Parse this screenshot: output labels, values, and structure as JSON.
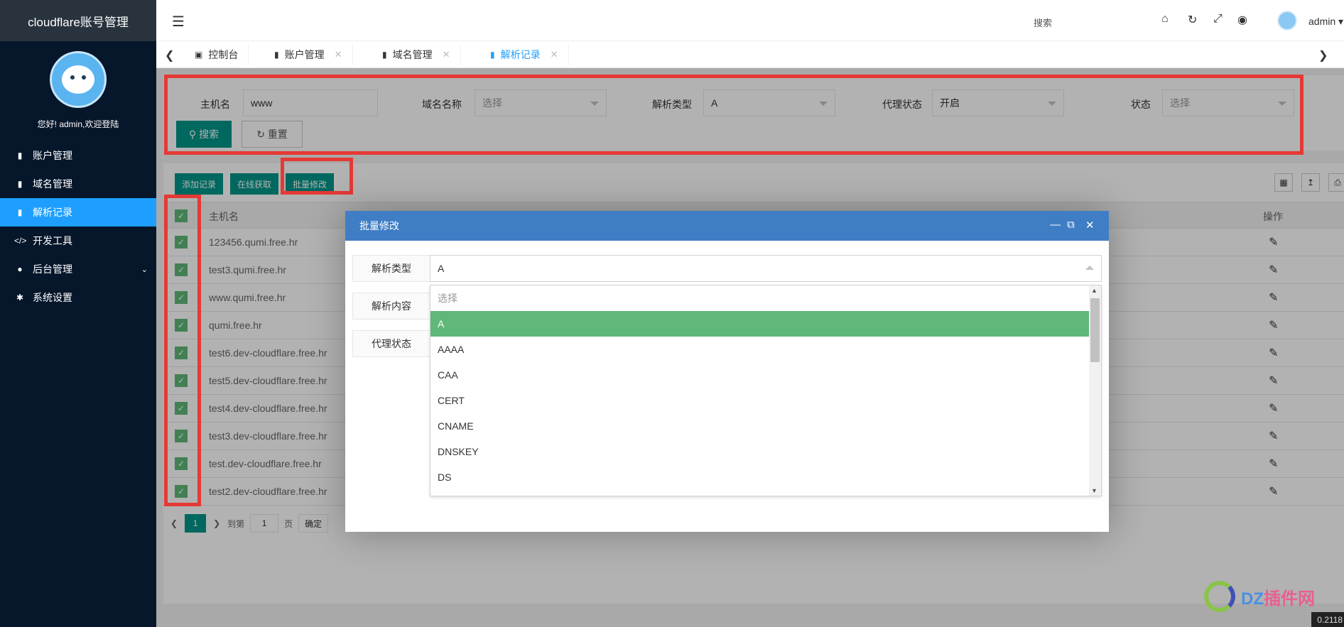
{
  "app": {
    "brand": "cloudflare账号管理",
    "welcome": "您好! admin,欢迎登陆"
  },
  "sidebar": {
    "items": [
      {
        "label": "账户管理",
        "icon": "book-icon"
      },
      {
        "label": "域名管理",
        "icon": "book-icon"
      },
      {
        "label": "解析记录",
        "icon": "book-icon",
        "active": true
      },
      {
        "label": "开发工具",
        "icon": "code-icon"
      },
      {
        "label": "后台管理",
        "icon": "users-icon",
        "has_children": true
      },
      {
        "label": "系统设置",
        "icon": "gear-icon"
      }
    ]
  },
  "header": {
    "search_label": "搜索",
    "user": "admin"
  },
  "tabs": [
    {
      "label": "控制台",
      "icon": "monitor-icon",
      "closable": false
    },
    {
      "label": "账户管理",
      "icon": "book-icon",
      "closable": true
    },
    {
      "label": "域名管理",
      "icon": "book-icon",
      "closable": true
    },
    {
      "label": "解析记录",
      "icon": "book-icon",
      "closable": true,
      "active": true
    }
  ],
  "filter": {
    "hostname_label": "主机名",
    "hostname_value": "www",
    "domain_label": "域名名称",
    "domain_placeholder": "选择",
    "type_label": "解析类型",
    "type_value": "A",
    "proxy_label": "代理状态",
    "proxy_value": "开启",
    "status_label": "状态",
    "status_placeholder": "选择",
    "search_button": "搜索",
    "reset_button": "重置"
  },
  "toolbar": {
    "add_label": "添加记录",
    "fetch_label": "在线获取",
    "batch_label": "批量修改"
  },
  "table": {
    "col_hostname": "主机名",
    "col_action": "操作",
    "rows": [
      "123456.qumi.free.hr",
      "test3.qumi.free.hr",
      "www.qumi.free.hr",
      "qumi.free.hr",
      "test6.dev-cloudflare.free.hr",
      "test5.dev-cloudflare.free.hr",
      "test4.dev-cloudflare.free.hr",
      "test3.dev-cloudflare.free.hr",
      "test.dev-cloudflare.free.hr",
      "test2.dev-cloudflare.free.hr"
    ]
  },
  "pager": {
    "current": "1",
    "goto_label": "到第",
    "input_value": "1",
    "page_label": "页",
    "confirm": "确定"
  },
  "modal": {
    "title": "批量修改",
    "type_label": "解析类型",
    "type_value": "A",
    "content_label": "解析内容",
    "proxy_label": "代理状态",
    "options": [
      "选择",
      "A",
      "AAAA",
      "CAA",
      "CERT",
      "CNAME",
      "DNSKEY",
      "DS"
    ],
    "selected": "A"
  },
  "watermark": {
    "text_a": "DZ",
    "text_b": "插件网"
  },
  "footer": {
    "version": "0.2118"
  },
  "colors": {
    "sidebar_bg": "#06162b",
    "accent_blue": "#1e9fff",
    "primary_green": "#009688",
    "selected_green": "#5fb878",
    "modal_header": "#3f7ec5",
    "highlight_red": "#e53935"
  }
}
